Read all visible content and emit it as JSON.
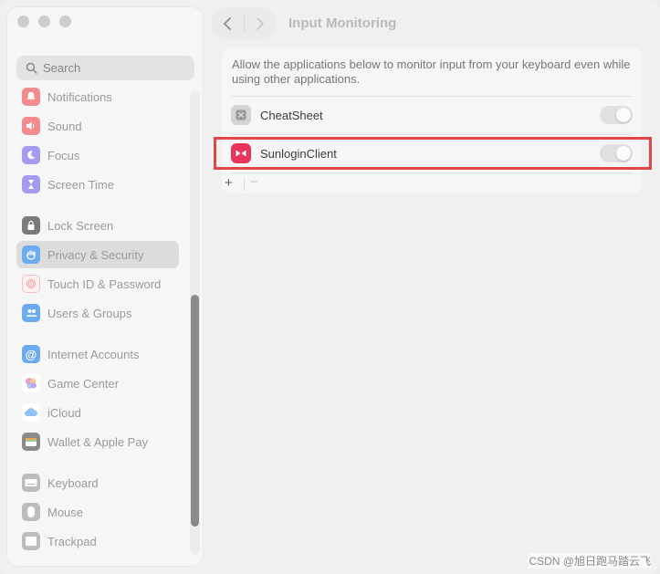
{
  "window": {
    "traffic_lights": [
      "close",
      "minimize",
      "zoom"
    ]
  },
  "sidebar": {
    "search_placeholder": "Search",
    "items": [
      {
        "label": "Notifications",
        "icon": "bell-icon",
        "color": "#f28b8b"
      },
      {
        "label": "Sound",
        "icon": "speaker-icon",
        "color": "#f28b8b"
      },
      {
        "label": "Focus",
        "icon": "moon-icon",
        "color": "#a49af0"
      },
      {
        "label": "Screen Time",
        "icon": "hourglass-icon",
        "color": "#a49af0"
      },
      {
        "label": "Lock Screen",
        "icon": "lock-icon",
        "color": "#7a7a7a"
      },
      {
        "label": "Privacy & Security",
        "icon": "hand-icon",
        "color": "#6cabf0",
        "selected": true
      },
      {
        "label": "Touch ID & Password",
        "icon": "fingerprint-icon",
        "color": "#f5b3b3"
      },
      {
        "label": "Users & Groups",
        "icon": "users-icon",
        "color": "#6cabf0"
      },
      {
        "label": "Internet Accounts",
        "icon": "at-icon",
        "color": "#6cabf0"
      },
      {
        "label": "Game Center",
        "icon": "game-center-icon",
        "color": "#f09cc7"
      },
      {
        "label": "iCloud",
        "icon": "cloud-icon",
        "color": "#8cc3f4"
      },
      {
        "label": "Wallet & Apple Pay",
        "icon": "wallet-icon",
        "color": "#8a8a8a"
      },
      {
        "label": "Keyboard",
        "icon": "keyboard-icon",
        "color": "#bdbdbd"
      },
      {
        "label": "Mouse",
        "icon": "mouse-icon",
        "color": "#bdbdbd"
      },
      {
        "label": "Trackpad",
        "icon": "trackpad-icon",
        "color": "#bdbdbd"
      }
    ]
  },
  "header": {
    "title": "Input Monitoring"
  },
  "main": {
    "description": "Allow the applications below to monitor input from your keyboard even while using other applications.",
    "apps": [
      {
        "name": "CheatSheet",
        "icon": "cheatsheet-icon",
        "enabled": false
      },
      {
        "name": "SunloginClient",
        "icon": "sunlogin-icon",
        "enabled": false,
        "highlighted": true
      }
    ],
    "add_label": "+",
    "remove_label": "−"
  },
  "watermark": "CSDN @旭日跑马踏云飞",
  "colors": {
    "highlight_border": "#e0454a",
    "sunlogin_brand": "#e8335c"
  }
}
